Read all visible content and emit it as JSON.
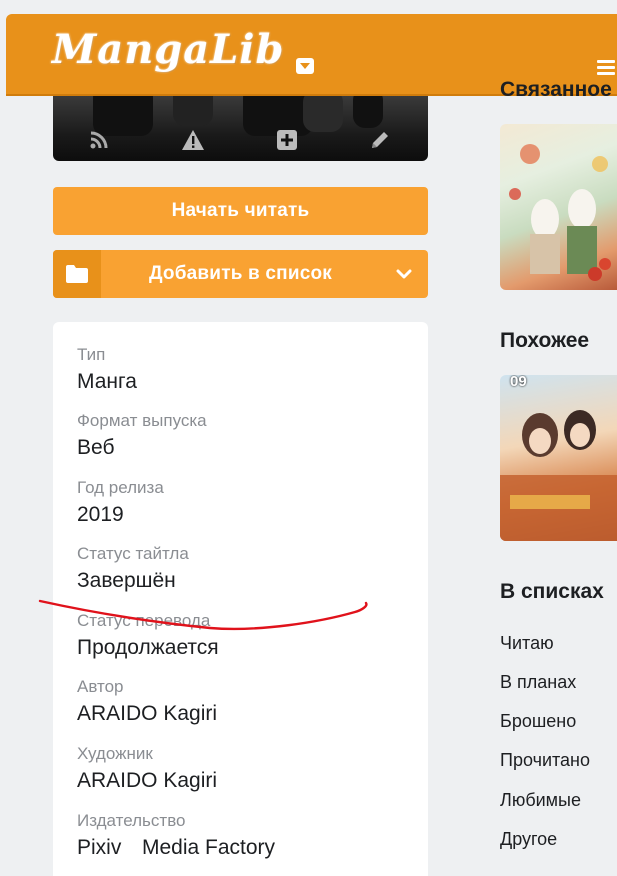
{
  "header": {
    "logo_text": "MangaLib",
    "accent_color": "#e8911a"
  },
  "cover_actions": {
    "icons": [
      "rss-icon",
      "warning-icon",
      "plus-square-icon",
      "pencil-icon"
    ]
  },
  "buttons": {
    "start_reading": "Начать читать",
    "add_to_list": "Добавить в список"
  },
  "info": {
    "type_label": "Тип",
    "type_value": "Манга",
    "format_label": "Формат выпуска",
    "format_value": "Веб",
    "year_label": "Год релиза",
    "year_value": "2019",
    "title_status_label": "Статус тайтла",
    "title_status_value": "Завершён",
    "translation_status_label": "Статус перевода",
    "translation_status_value": "Продолжается",
    "author_label": "Автор",
    "author_value": "ARAIDO Kagiri",
    "artist_label": "Художник",
    "artist_value": "ARAIDO Kagiri",
    "publisher_label": "Издательство",
    "publisher_values": [
      "Pixiv",
      "Media Factory"
    ]
  },
  "sidebar": {
    "related_title": "Связанное",
    "similar_title": "Похожее",
    "lists_title": "В списках",
    "list_items": [
      "Читаю",
      "В планах",
      "Брошено",
      "Прочитано",
      "Любимые",
      "Другое"
    ],
    "similar_badge": "09"
  }
}
